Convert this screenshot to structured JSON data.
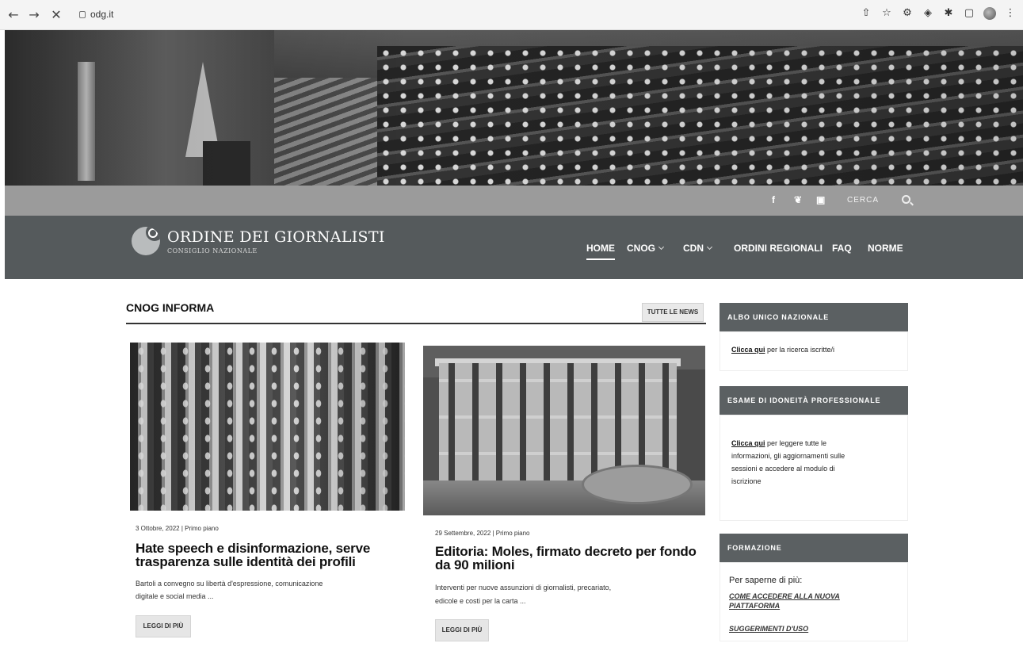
{
  "browser": {
    "url": "odg.it"
  },
  "social": {
    "facebook": "f",
    "twitter": "❦",
    "instagram": "▣",
    "search_label": "CERCA"
  },
  "header": {
    "brand": "ORDINE DEI GIORNALISTI",
    "brand_sub": "CONSIGLIO NAZIONALE",
    "menu": {
      "home": "HOME",
      "cnog": "CNOG",
      "cdn": "CDN",
      "regional": "ORDINI REGIONALI",
      "faq": "FAQ",
      "norme": "NORME"
    }
  },
  "news": {
    "section_title": "CNOG INFORMA",
    "all_news": "TUTTE LE NEWS",
    "articles": [
      {
        "meta": "3 Ottobre, 2022 | Primo piano",
        "title_line1": "Hate speech e disinformazione, serve",
        "title_line2": "trasparenza sulle identità dei profili",
        "excerpt_line1": "Bartoli a convegno  su libertà d'espressione, comunicazione",
        "excerpt_line2": "digitale e  social media          ...",
        "read_more": "LEGGI DI PIÙ"
      },
      {
        "meta": "29 Settembre, 2022 | Primo piano",
        "title_line1": "Editoria: Moles, firmato decreto per fondo",
        "title_line2": "da 90 milioni",
        "excerpt_line1": "Interventi per  nuove assunzioni di giornalisti,  precariato,",
        "excerpt_line2": "edicole e costi per la carta      ...",
        "read_more": "LEGGI DI PIÙ"
      }
    ]
  },
  "sidebar": {
    "albo": {
      "heading": "ALBO UNICO NAZIONALE",
      "link": "Clicca qui",
      "text": " per la ricerca iscritte/i"
    },
    "esame": {
      "heading": "ESAME DI IDONEITÀ PROFESSIONALE",
      "link": "Clicca  qui",
      "line1": " per leggere tutte le",
      "line2": "informazioni, gli aggiornamenti sulle",
      "line3": "sessioni e accedere al modulo di",
      "line4": "iscrizione"
    },
    "formazione": {
      "heading": "FORMAZIONE",
      "intro": "Per saperne di più:",
      "link1_line1": "COME ACCEDERE ALLA NUOVA",
      "link1_line2": "PIATTAFORMA",
      "link2": "SUGGERIMENTI D'USO"
    }
  }
}
